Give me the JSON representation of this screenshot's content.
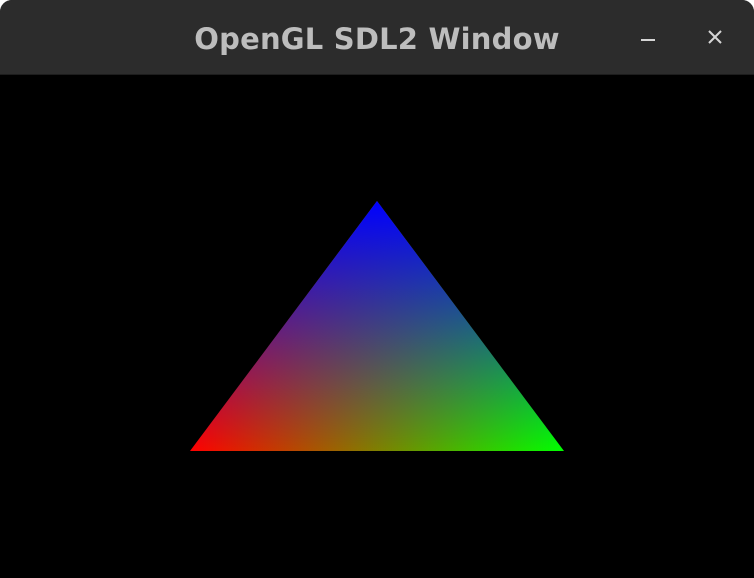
{
  "window": {
    "title": "OpenGL SDL2 Window",
    "controls": {
      "minimize_icon": "minimize-icon",
      "close_icon": "close-icon"
    }
  },
  "scene": {
    "background_color": "#000000",
    "triangle": {
      "vertex_colors": {
        "top": "#0000ff",
        "bottom_left": "#ff0000",
        "bottom_right": "#00ff00"
      }
    }
  },
  "colors": {
    "titlebar": "#2c2c2c",
    "title_text": "#bdbdbd"
  }
}
